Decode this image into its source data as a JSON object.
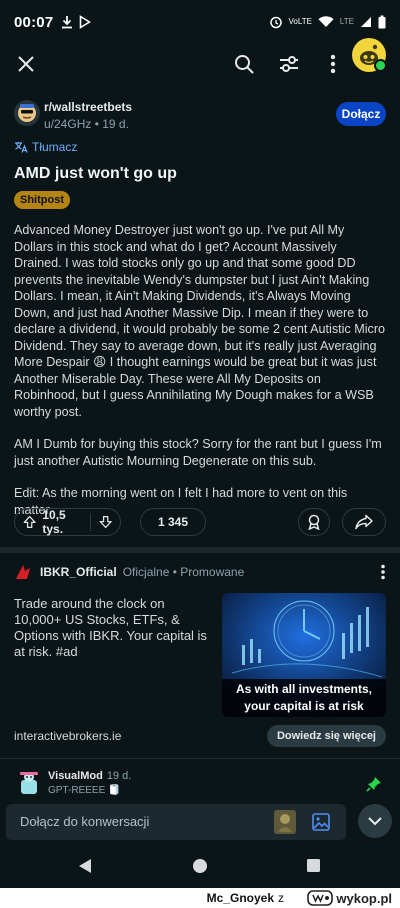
{
  "status_bar": {
    "time": "00:07",
    "volte_label": "VoLTE",
    "lte_label": "LTE"
  },
  "subreddit": {
    "name": "r/wallstreetbets",
    "meta": "u/24GHz • 19 d.",
    "join_label": "Dołącz"
  },
  "translator_label": "Tłumacz",
  "post": {
    "title": "AMD just won't go up",
    "flair": "Shitpost",
    "paragraphs": [
      "Advanced Money Destroyer just won't go up. I've put All My Dollars in this stock and what do I get? Account Massively Drained. I was told stocks only go up and that some good DD prevents the inevitable Wendy's dumpster but I just Ain't Making Dollars. I mean, it Ain't Making Dividends, it's Always Moving Down, and just had Another Massive Dip. I mean if they were to declare a dividend, it would probably be some 2 cent Autistic Micro Dividend. They say to average down, but it's really just Averaging More Despair 😩 I thought earnings would be great but it was just Another Miserable Day. These were All My Deposits on Robinhood, but I guess Annihilating My Dough makes for a WSB worthy post.",
      "AM I Dumb for buying this stock? Sorry for the rant but I guess I'm just another Autistic Mourning Degenerate on this sub.",
      "Edit: As the morning went on I felt I had more to vent on this matter."
    ],
    "votes": "10,5 tys.",
    "comments": "1 345"
  },
  "ad": {
    "advertiser": "IBKR_Official",
    "meta": "Oficjalne • Promowane",
    "text": "Trade around the clock on 10,000+ US Stocks, ETFs, & Options with IBKR. Your capital is at risk. #ad",
    "image_caption": "As with all investments, your capital is at risk",
    "link": "interactivebrokers.ie",
    "cta_label": "Dowiedz się więcej"
  },
  "comment_preview": {
    "user": "VisualMod",
    "time": "19 d.",
    "flair": "GPT-REEEE 🧻"
  },
  "composer": {
    "placeholder": "Dołącz do konwersacji"
  },
  "footer": {
    "user": "Mc_Gnoyek",
    "separator": "z",
    "site": "wykop.pl"
  },
  "colors": {
    "background": "#0b1416",
    "accent_blue": "#0a45c6",
    "flair": "#b58513",
    "online": "#2bd34f"
  }
}
